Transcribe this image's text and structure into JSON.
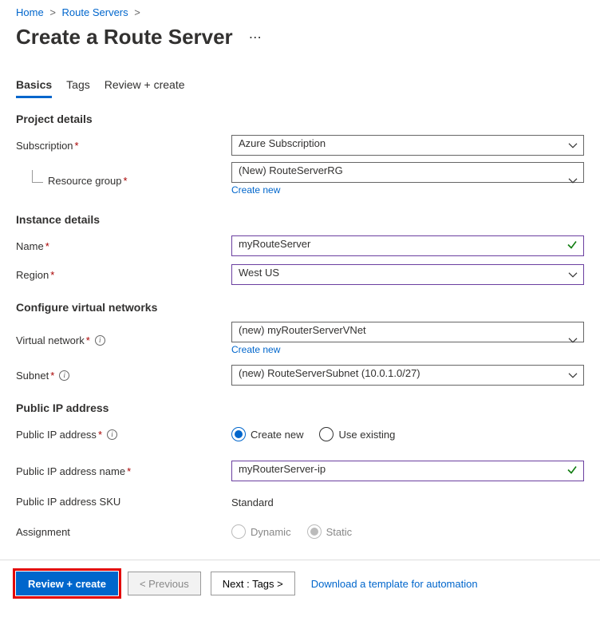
{
  "breadcrumb": {
    "items": [
      "Home",
      "Route Servers"
    ]
  },
  "title": "Create a Route Server",
  "tabs": [
    {
      "label": "Basics"
    },
    {
      "label": "Tags"
    },
    {
      "label": "Review + create"
    }
  ],
  "sections": {
    "project": {
      "heading": "Project details",
      "subscription": {
        "label": "Subscription",
        "value": "Azure Subscription"
      },
      "resource_group": {
        "label": "Resource group",
        "value": "(New) RouteServerRG",
        "create_new": "Create new"
      }
    },
    "instance": {
      "heading": "Instance details",
      "name": {
        "label": "Name",
        "value": "myRouteServer"
      },
      "region": {
        "label": "Region",
        "value": "West US"
      }
    },
    "vnet": {
      "heading": "Configure virtual networks",
      "virtual_network": {
        "label": "Virtual network",
        "value": "(new) myRouterServerVNet",
        "create_new": "Create new"
      },
      "subnet": {
        "label": "Subnet",
        "value": "(new) RouteServerSubnet (10.0.1.0/27)"
      }
    },
    "pip": {
      "heading": "Public IP address",
      "address": {
        "label": "Public IP address",
        "create_new": "Create new",
        "use_existing": "Use existing"
      },
      "name": {
        "label": "Public IP address name",
        "value": "myRouterServer-ip"
      },
      "sku": {
        "label": "Public IP address SKU",
        "value": "Standard"
      },
      "assignment": {
        "label": "Assignment",
        "dynamic": "Dynamic",
        "static": "Static"
      }
    }
  },
  "footer": {
    "review_create": "Review + create",
    "previous": "< Previous",
    "next": "Next : Tags >",
    "download": "Download a template for automation"
  }
}
